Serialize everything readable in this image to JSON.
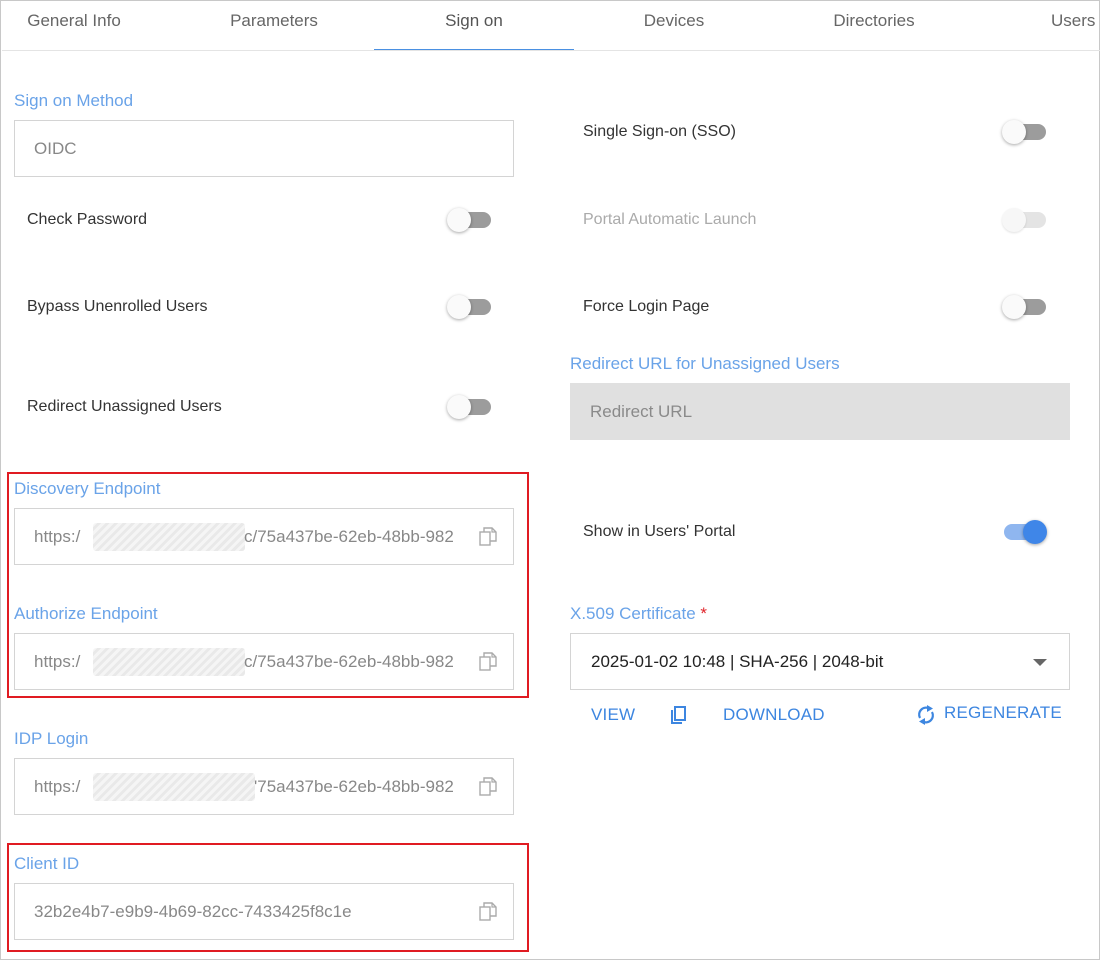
{
  "tabs": [
    {
      "label": "General Info"
    },
    {
      "label": "Parameters"
    },
    {
      "label": "Sign on"
    },
    {
      "label": "Devices"
    },
    {
      "label": "Directories"
    },
    {
      "label": "Users"
    }
  ],
  "left": {
    "sign_on_method": {
      "label": "Sign on Method",
      "value": "OIDC"
    },
    "check_password": {
      "label": "Check Password",
      "on": false
    },
    "bypass_unenrolled": {
      "label": "Bypass Unenrolled Users",
      "on": false
    },
    "redirect_unassigned": {
      "label": "Redirect Unassigned Users",
      "on": false
    },
    "discovery_endpoint": {
      "label": "Discovery Endpoint",
      "prefix": "https:/",
      "suffix": "c/75a437be-62eb-48bb-982"
    },
    "authorize_endpoint": {
      "label": "Authorize Endpoint",
      "prefix": "https:/",
      "suffix": "c/75a437be-62eb-48bb-982"
    },
    "idp_login": {
      "label": "IDP Login",
      "prefix": "https:/",
      "suffix": "'75a437be-62eb-48bb-982"
    },
    "client_id": {
      "label": "Client ID",
      "value": "32b2e4b7-e9b9-4b69-82cc-7433425f8c1e"
    }
  },
  "right": {
    "sso": {
      "label": "Single Sign-on (SSO)",
      "on": false
    },
    "portal_auto_launch": {
      "label": "Portal Automatic Launch",
      "on": false,
      "disabled": true
    },
    "force_login": {
      "label": "Force Login Page",
      "on": false
    },
    "redirect_url": {
      "label": "Redirect URL for Unassigned Users",
      "placeholder": "Redirect URL"
    },
    "show_in_portal": {
      "label": "Show in Users' Portal",
      "on": true
    },
    "certificate": {
      "label": "X.509 Certificate",
      "required_mark": "*",
      "value": "2025-01-02 10:48 | SHA-256 | 2048-bit"
    },
    "actions": {
      "view": "VIEW",
      "download": "DOWNLOAD",
      "regenerate": "REGENERATE"
    }
  },
  "icons": {
    "copy": "copy-icon",
    "duplicate": "duplicate-icon",
    "refresh": "refresh-icon",
    "caret": "chevron-down-icon"
  },
  "colors": {
    "accent": "#3d86e0",
    "label": "#6aa3e8",
    "highlight": "#e01b22"
  }
}
